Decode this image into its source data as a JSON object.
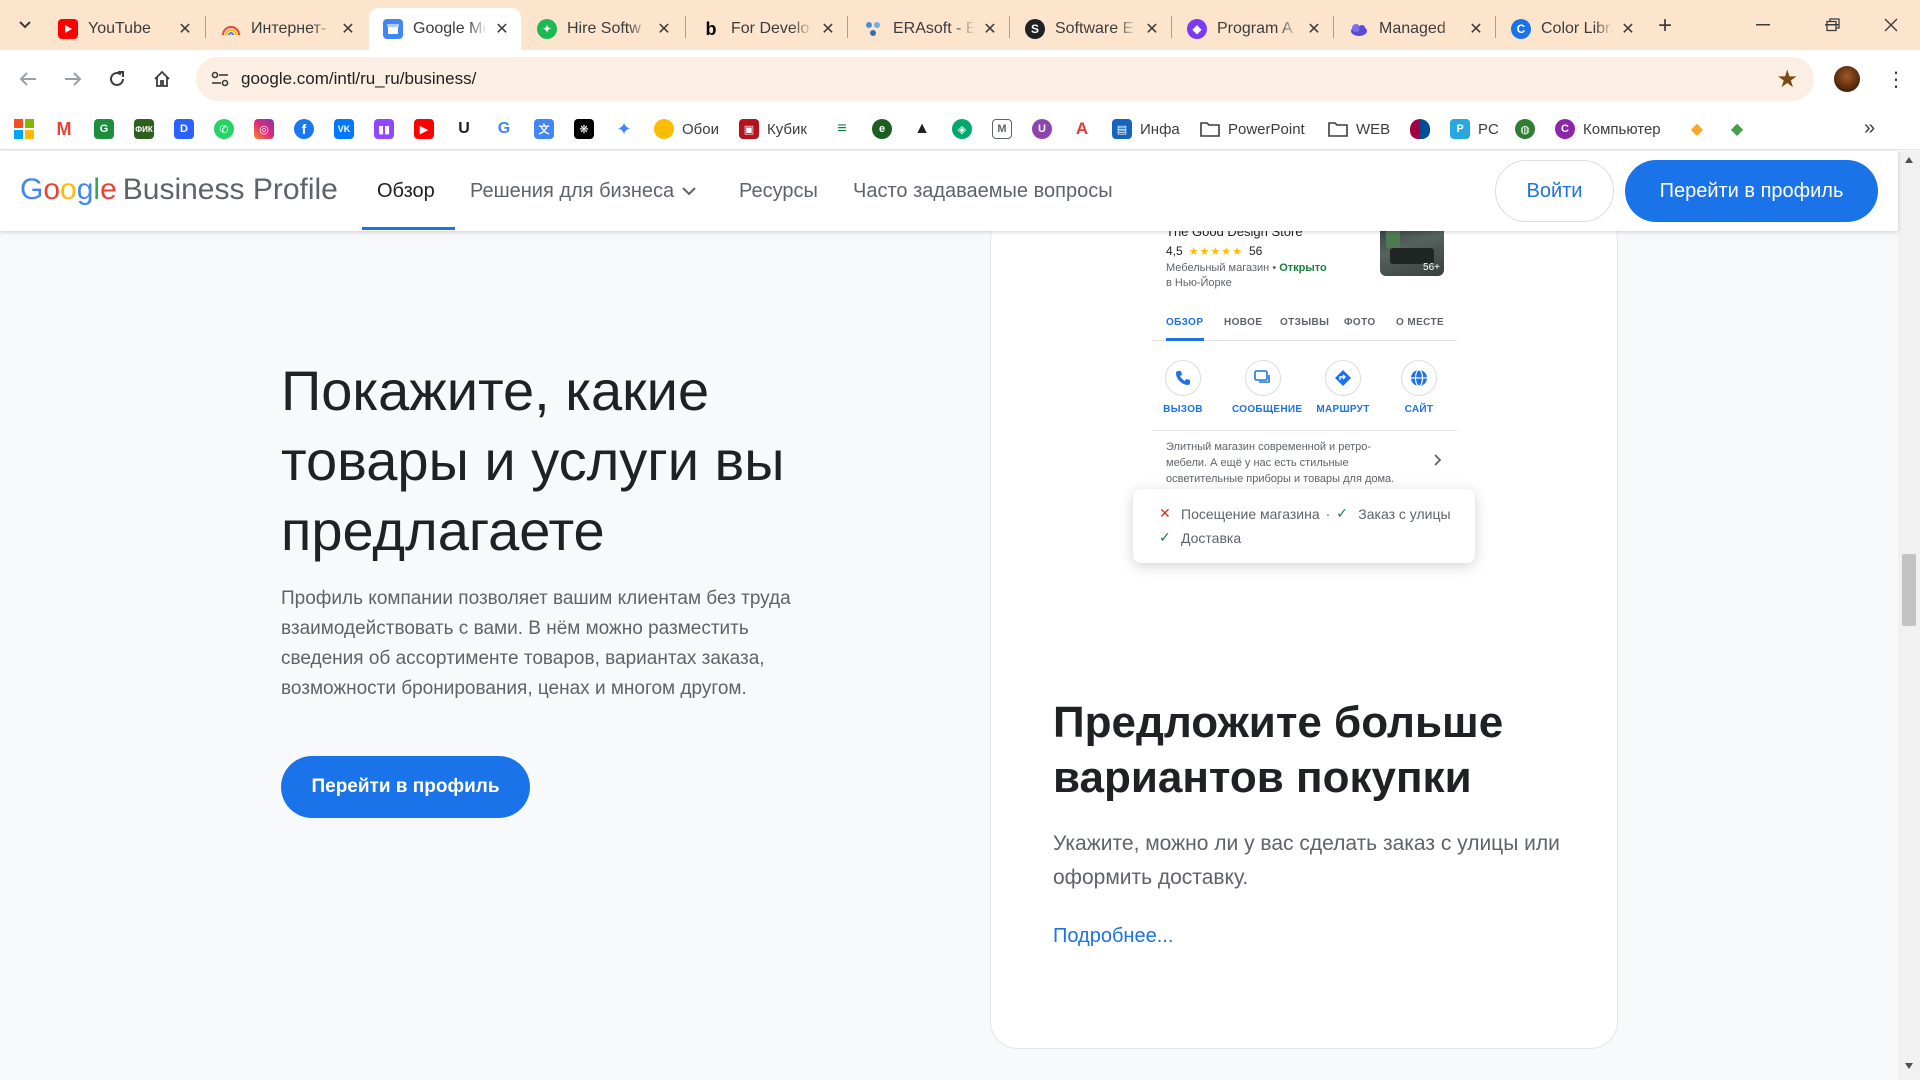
{
  "browser": {
    "tabs": [
      {
        "title": "YouTube"
      },
      {
        "title": "Интернет-"
      },
      {
        "title": "Google Мой"
      },
      {
        "title": "Hire Softw"
      },
      {
        "title": "For Develo"
      },
      {
        "title": "ERAsoft - E"
      },
      {
        "title": "Software E"
      },
      {
        "title": "Program A"
      },
      {
        "title": "Managed"
      },
      {
        "title": "Color Libra"
      }
    ],
    "active_tab_index": 2,
    "address_bar": {
      "url": "google.com/intl/ru_ru/business/"
    },
    "bookmarks": [
      {
        "icon": "windows-icon"
      },
      {
        "icon": "gmail-icon"
      },
      {
        "icon": "google-classroom-icon"
      },
      {
        "icon": "fik-icon"
      },
      {
        "icon": "d-icon"
      },
      {
        "icon": "whatsapp-icon"
      },
      {
        "icon": "instagram-icon"
      },
      {
        "icon": "facebook-icon"
      },
      {
        "icon": "vk-icon"
      },
      {
        "icon": "twitch-icon"
      },
      {
        "icon": "youtube-icon"
      },
      {
        "icon": "u-icon"
      },
      {
        "icon": "google-icon"
      },
      {
        "icon": "google-translate-icon"
      },
      {
        "icon": "chatgpt-icon"
      },
      {
        "icon": "gemini-icon"
      },
      {
        "label": "Обои",
        "icon": "bulb-icon"
      },
      {
        "label": "Кубик",
        "icon": "cube-icon"
      },
      {
        "icon": "stripes-icon"
      },
      {
        "icon": "e-icon"
      },
      {
        "icon": "graduation-cap-icon"
      },
      {
        "icon": "shield-icon"
      },
      {
        "icon": "m-icon"
      },
      {
        "icon": "u-circle-icon"
      },
      {
        "icon": "a-icon"
      },
      {
        "label": "Инфа",
        "icon": "book-icon"
      },
      {
        "label": "PowerPoint",
        "icon": "folder-icon"
      },
      {
        "label": "WEB",
        "icon": "folder-icon"
      },
      {
        "icon": "fc-barcelona-icon"
      },
      {
        "label": "PC",
        "icon": "pc-icon"
      },
      {
        "icon": "globe-icon"
      },
      {
        "label": "Компьютер",
        "icon": "c-logo-icon"
      },
      {
        "icon": "code-diamond-icon"
      },
      {
        "icon": "code-diamond-alt-icon"
      }
    ]
  },
  "header": {
    "logo_google": [
      "G",
      "o",
      "o",
      "g",
      "l",
      "e"
    ],
    "logo_product": "Business Profile",
    "nav": [
      {
        "label": "Обзор"
      },
      {
        "label": "Решения для бизнеса"
      },
      {
        "label": "Ресурсы"
      },
      {
        "label": "Часто задаваемые вопросы"
      }
    ],
    "login_label": "Войти",
    "profile_label": "Перейти в профиль"
  },
  "hero": {
    "title": "Покажите, какие товары и услуги вы предлагаете",
    "text": "Профиль компании позволяет вашим клиентам без труда взаимодействовать с вами. В нём можно разместить сведения об ассортименте товаров, вариантах заказа, возможности бронирования, ценах и многом другом.",
    "button": "Перейти в профиль"
  },
  "mockup": {
    "store_name": "The Good Design Store",
    "rating": "4,5",
    "stars": "★★★★★",
    "reviews": "56",
    "type": "Мебельный магазин",
    "status_sep": "•",
    "status": "Открыто",
    "location": "в Нью-Йорке",
    "photo_count": "56+",
    "tabs": [
      "ОБЗОР",
      "НОВОЕ",
      "ОТЗЫВЫ",
      "ФОТО",
      "О МЕСТЕ"
    ],
    "actions": [
      {
        "label": "ВЫЗОВ",
        "icon": "phone-icon"
      },
      {
        "label": "СООБЩЕНИЕ",
        "icon": "chat-icon"
      },
      {
        "label": "МАРШРУТ",
        "icon": "directions-icon"
      },
      {
        "label": "САЙТ",
        "icon": "globe-icon"
      }
    ],
    "description": "Элитный магазин современной и ретро-мебели. А ещё у нас есть стильные осветительные приборы и товары для дома.",
    "attributes": [
      {
        "label": "Посещение магазина",
        "available": false
      },
      {
        "label": "Заказ с улицы",
        "available": true
      },
      {
        "label": "Доставка",
        "available": true
      }
    ],
    "attr_separator": "·"
  },
  "card": {
    "title": "Предложите больше вариантов покупки",
    "text": "Укажите, можно ли у вас сделать заказ с улицы или оформить доставку.",
    "link": "Подробнее..."
  }
}
